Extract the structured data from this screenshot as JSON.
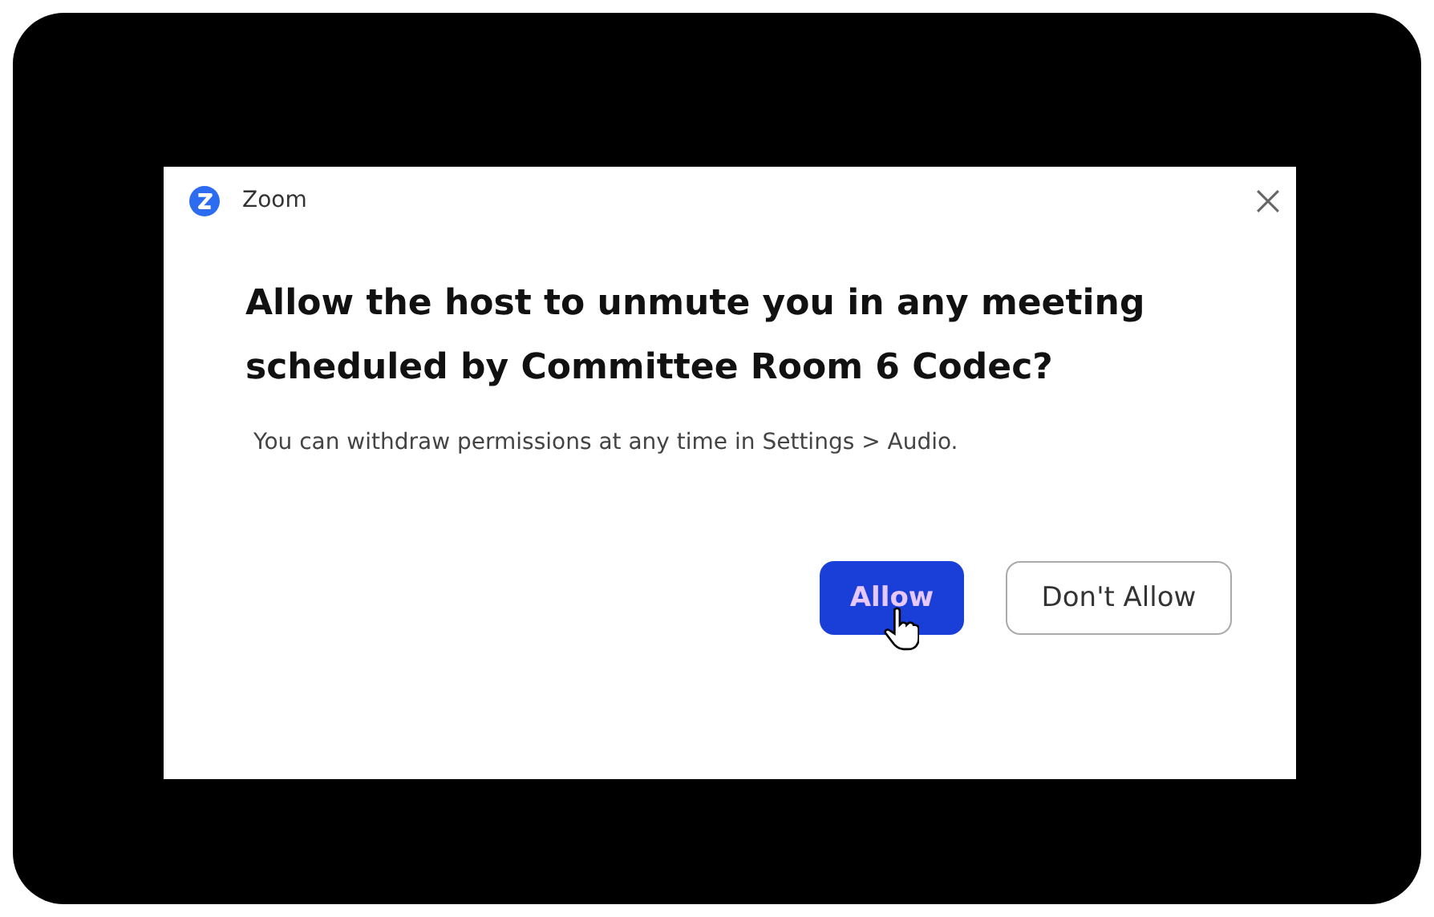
{
  "window": {
    "title": "Zoom"
  },
  "heading": "Allow the host to unmute you in any meeting scheduled by Committee Room 6 Codec?",
  "message": "You can withdraw permissions at any time in Settings > Audio.",
  "buttons": [
    {
      "label": "Allow",
      "kind": "primary"
    },
    {
      "label": "Don't Allow",
      "kind": "secondary"
    }
  ]
}
